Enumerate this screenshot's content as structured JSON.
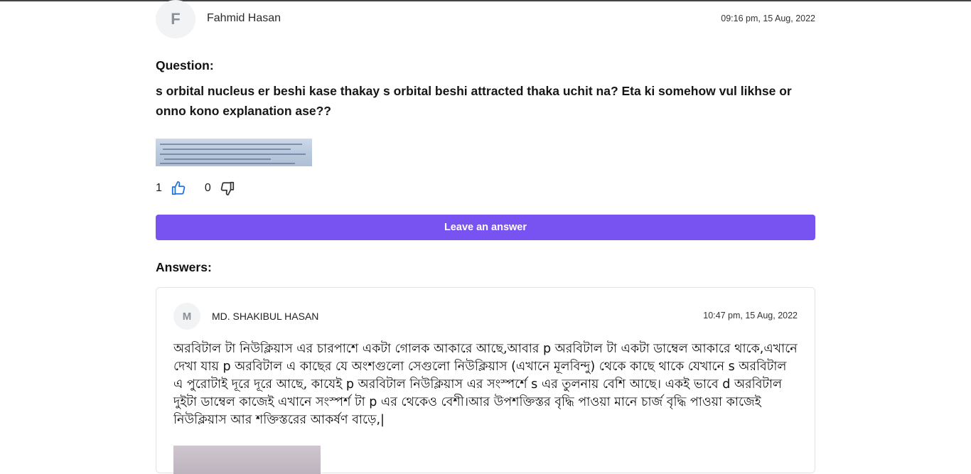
{
  "question": {
    "author_initial": "F",
    "author_name": "Fahmid Hasan",
    "timestamp": "09:16 pm, 15 Aug, 2022",
    "label": "Question:",
    "text": "s orbital nucleus er beshi kase thakay s orbital beshi attracted thaka uchit na? Eta ki somehow vul likhse or onno kono explanation ase??",
    "upvotes": "1",
    "downvotes": "0"
  },
  "actions": {
    "leave_answer_label": "Leave an answer"
  },
  "answers_section": {
    "label": "Answers:",
    "items": [
      {
        "author_initial": "M",
        "author_name": "MD. SHAKIBUL HASAN",
        "timestamp": "10:47 pm, 15 Aug, 2022",
        "text": "অরবিটাল টা নিউক্লিয়াস এর চারপাশে একটা গোলক আকারে আছে,আবার p অরবিটাল টা একটা ডাম্বেল আকারে থাকে,এখানে দেখা যায় p অরবিটাল এ কাছের যে অংশগুলো সেগুলো নিউক্লিয়াস (এখানে মূলবিন্দু) থেকে কাছে থাকে যেখানে s অরবিটাল এ পুরোটাই দূরে দূরে আছে, কাযেই p অরবিটাল নিউক্লিয়াস এর সংস্পর্শে s এর তুলনায় বেশি আছে। একই ভাবে d অরবিটাল দুইটা ডাম্বেল কাজেই এখানে সংস্পর্শ টা p এর থেকেও বেশী।আর উপশক্তিস্তর বৃদ্ধি পাওয়া মানে চার্জ বৃদ্ধি পাওয়া কাজেই নিউক্লিয়াস আর শক্তিস্তরের আকর্ষণ বাড়ে,|"
      }
    ]
  },
  "icons": {
    "upvote": "thumbs-up-icon",
    "downvote": "thumbs-down-icon"
  },
  "colors": {
    "accent": "#7952f2",
    "upvote_icon": "#1e6fd9",
    "downvote_icon": "#333333"
  }
}
